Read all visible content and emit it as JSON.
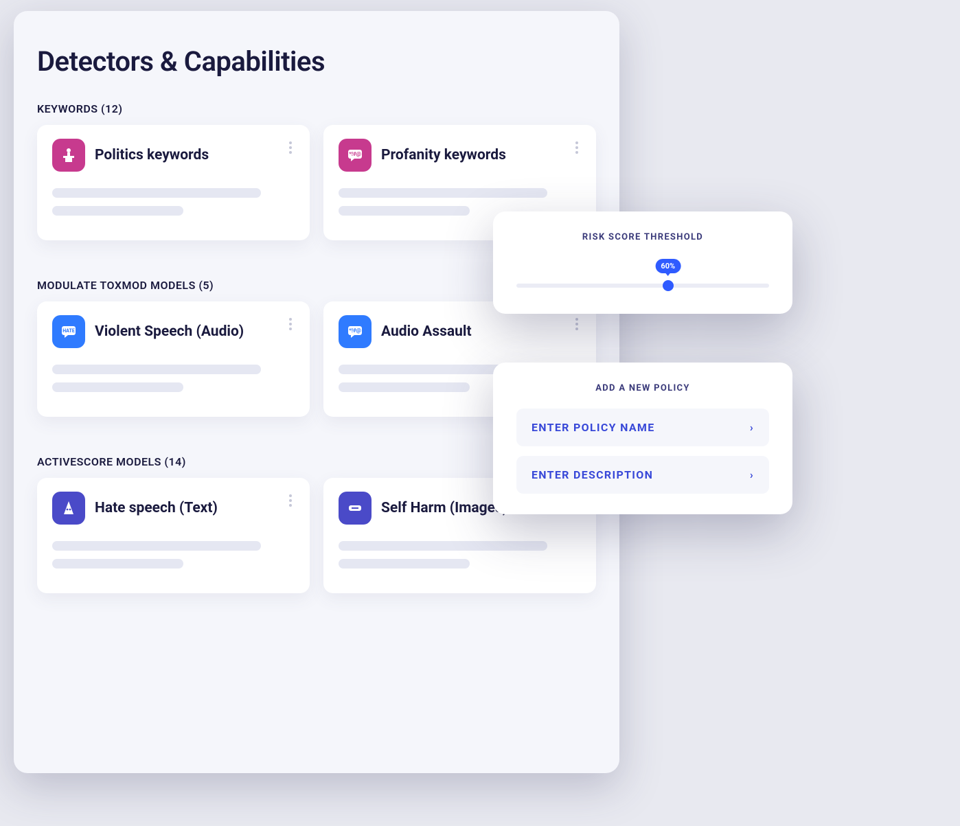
{
  "page_title": "Detectors & Capabilities",
  "sections": {
    "keywords": {
      "header": "KEYWORDS (12)",
      "cards": [
        {
          "title": "Politics keywords",
          "icon": "podium-icon",
          "icon_color": "pink"
        },
        {
          "title": "Profanity keywords",
          "icon": "swear-bubble-icon",
          "icon_color": "pink"
        }
      ]
    },
    "toxmod": {
      "header": "MODULATE TOXMOD MODELS (5)",
      "cards": [
        {
          "title": "Violent Speech (Audio)",
          "icon": "hate-bubble-icon",
          "icon_color": "blue"
        },
        {
          "title": "Audio Assault",
          "icon": "swear-bubble-icon",
          "icon_color": "blue"
        }
      ]
    },
    "activescore": {
      "header": "ACTIVESCORE MODELS (14)",
      "cards": [
        {
          "title": "Hate speech (Text)",
          "icon": "hood-icon",
          "icon_color": "indigo"
        },
        {
          "title": "Self Harm (Images)",
          "icon": "razor-icon",
          "icon_color": "indigo"
        }
      ]
    }
  },
  "risk_panel": {
    "title": "RISK SCORE THRESHOLD",
    "value_label": "60%",
    "value_percent": 60
  },
  "policy_panel": {
    "title": "ADD A NEW POLICY",
    "name_placeholder": "ENTER POLICY NAME",
    "desc_placeholder": "ENTER DESCRIPTION"
  },
  "colors": {
    "pink": "#c73a8e",
    "blue": "#2f7bff",
    "indigo": "#4a4ac8",
    "accent": "#2f5bff"
  }
}
